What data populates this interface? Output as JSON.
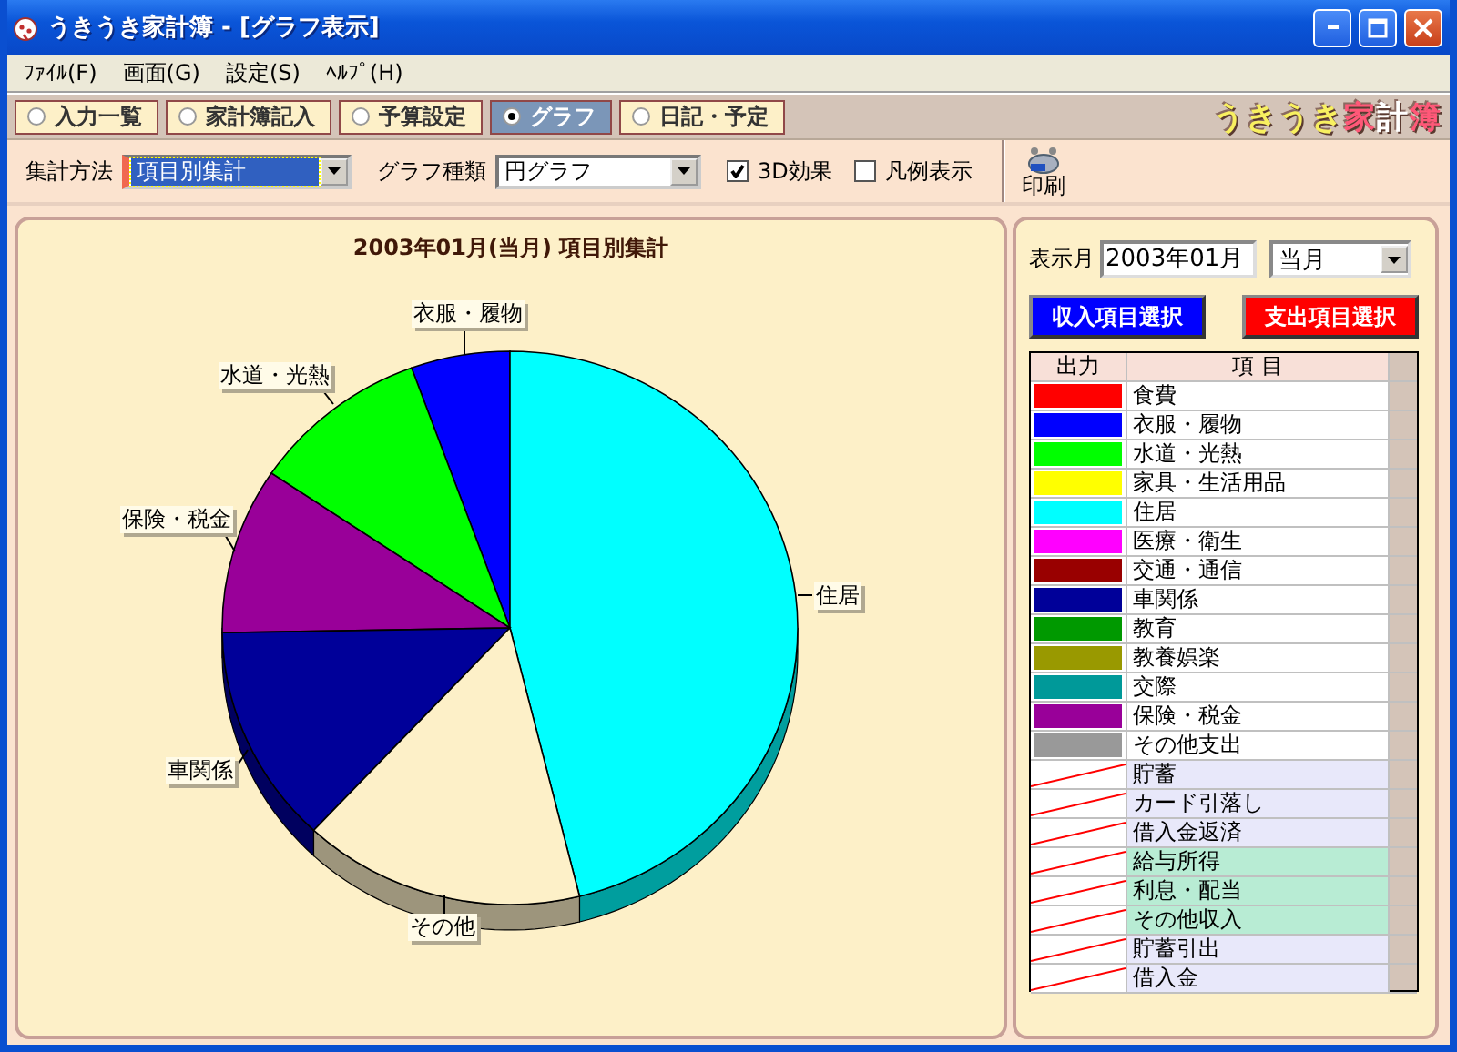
{
  "window": {
    "title": "うきうき家計簿 - [グラフ表示]"
  },
  "menu": [
    "ﾌｧｲﾙ(F)",
    "画面(G)",
    "設定(S)",
    "ﾍﾙﾌﾟ(H)"
  ],
  "tabs": [
    {
      "label": "入力一覧",
      "selected": false
    },
    {
      "label": "家計簿記入",
      "selected": false
    },
    {
      "label": "予算設定",
      "selected": false
    },
    {
      "label": "グラフ",
      "selected": true
    },
    {
      "label": "日記・予定",
      "selected": false
    }
  ],
  "logo": "うきうき家計簿",
  "toolbar": {
    "combos": [
      {
        "label": "集計方法",
        "value": "項目別集計",
        "focused": true
      },
      {
        "label": "グラフ種類",
        "value": "円グラフ",
        "focused": false
      }
    ],
    "checkboxes": [
      {
        "label": "3D効果",
        "checked": true
      },
      {
        "label": "凡例表示",
        "checked": false
      }
    ],
    "print_button": "印刷"
  },
  "chart": {
    "title": "2003年01月(当月) 項目別集計",
    "slices": [
      {
        "label": "衣服・履物",
        "color": "#0000ff"
      },
      {
        "label": "水道・光熱",
        "color": "#00ff00"
      },
      {
        "label": "保険・税金",
        "color": "#990099"
      },
      {
        "label": "住居",
        "color": "#00ffff"
      },
      {
        "label": "車関係",
        "color": "#000099"
      },
      {
        "label": "その他",
        "color": "#fdf0c8"
      }
    ]
  },
  "side": {
    "month_label": "表示月",
    "month_value": "2003年01月",
    "period": "当月",
    "buttons": [
      {
        "label": "収入項目選択",
        "color": "#0000ff"
      },
      {
        "label": "支出項目選択",
        "color": "#ff0000"
      }
    ],
    "columns": [
      "出力",
      "項 目"
    ],
    "rows": [
      {
        "name": "食費",
        "kind": "expense",
        "color": "#ff0000"
      },
      {
        "name": "衣服・履物",
        "kind": "expense",
        "color": "#0000ff"
      },
      {
        "name": "水道・光熱",
        "kind": "expense",
        "color": "#00ff00"
      },
      {
        "name": "家具・生活用品",
        "kind": "expense",
        "color": "#ffff00"
      },
      {
        "name": "住居",
        "kind": "expense",
        "color": "#00ffff"
      },
      {
        "name": "医療・衛生",
        "kind": "expense",
        "color": "#ff00ff"
      },
      {
        "name": "交通・通信",
        "kind": "expense",
        "color": "#990000"
      },
      {
        "name": "車関係",
        "kind": "expense",
        "color": "#000099"
      },
      {
        "name": "教育",
        "kind": "expense",
        "color": "#009900"
      },
      {
        "name": "教養娯楽",
        "kind": "expense",
        "color": "#999900"
      },
      {
        "name": "交際",
        "kind": "expense",
        "color": "#009999"
      },
      {
        "name": "保険・税金",
        "kind": "expense",
        "color": "#990099"
      },
      {
        "name": "その他支出",
        "kind": "expense",
        "color": "#999999"
      },
      {
        "name": "貯蓄",
        "kind": "transfer"
      },
      {
        "name": "カード引落し",
        "kind": "transfer"
      },
      {
        "name": "借入金返済",
        "kind": "transfer"
      },
      {
        "name": "給与所得",
        "kind": "income"
      },
      {
        "name": "利息・配当",
        "kind": "income"
      },
      {
        "name": "その他収入",
        "kind": "income"
      },
      {
        "name": "貯蓄引出",
        "kind": "transfer"
      },
      {
        "name": "借入金",
        "kind": "transfer"
      }
    ]
  }
}
